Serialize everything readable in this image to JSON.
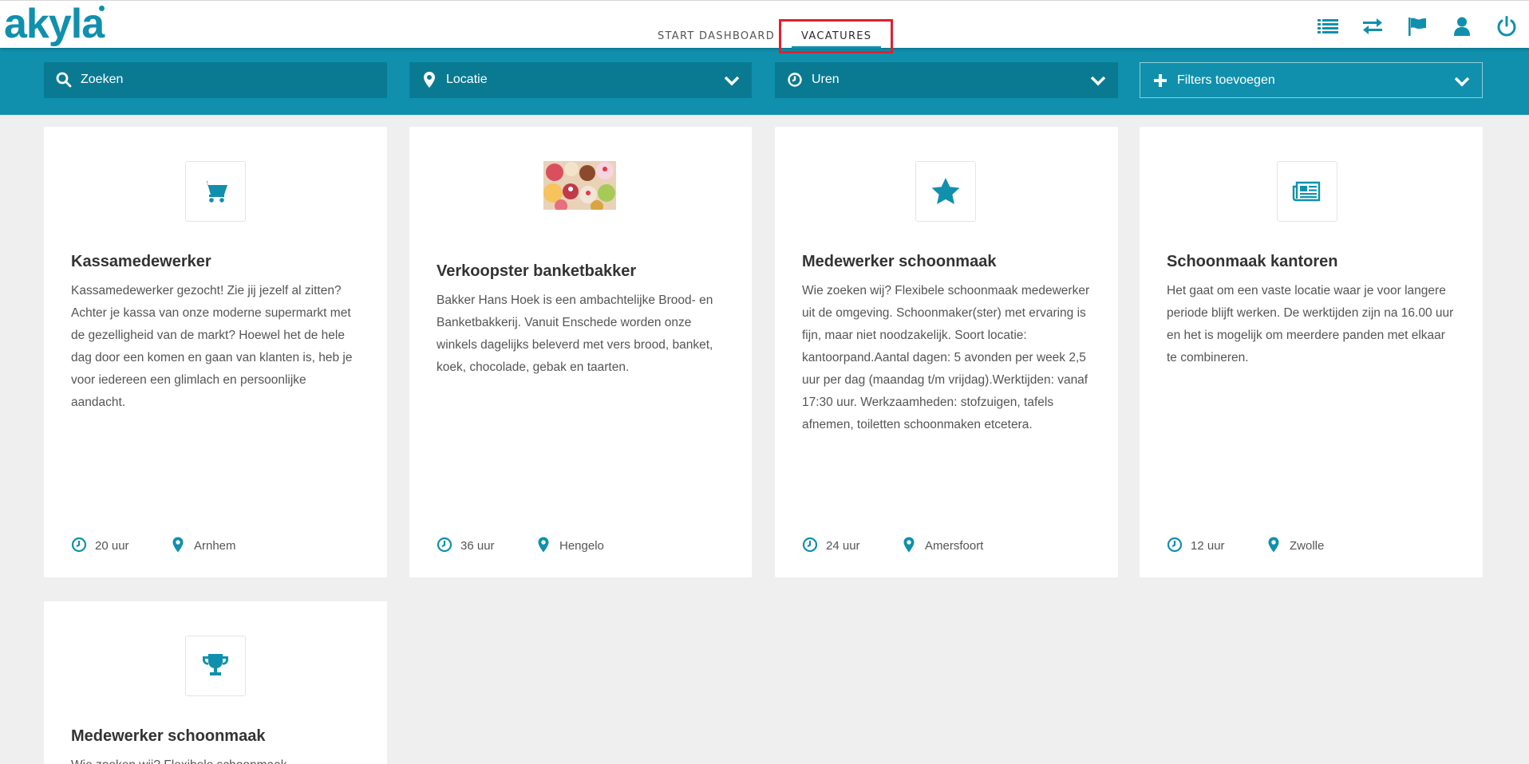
{
  "brand": {
    "logo_text": "akyla",
    "color": "#1090ad"
  },
  "nav": {
    "tabs": [
      {
        "label": "START DASHBOARD",
        "active": false
      },
      {
        "label": "VACATURES",
        "active": true
      }
    ]
  },
  "top_icons": [
    "list-icon",
    "transfer-icon",
    "flag-icon",
    "user-icon",
    "power-icon"
  ],
  "filters": {
    "search": {
      "placeholder": "Zoeken",
      "icon": "search-icon"
    },
    "location": {
      "label": "Locatie",
      "icon": "map-marker-icon"
    },
    "hours": {
      "label": "Uren",
      "icon": "clock-icon"
    },
    "add_filters": {
      "label": "Filters toevoegen",
      "icon": "plus-icon"
    }
  },
  "vacancies": [
    {
      "icon": "shopping-cart-icon",
      "title": "Kassamedewerker",
      "description": "Kassamedewerker gezocht! Zie jij jezelf al zitten? Achter je kassa van onze moderne supermarkt met de gezelligheid van de markt? Hoewel het de hele dag door een komen en gaan van klanten is, heb je voor iedereen een glimlach en persoonlijke aandacht.",
      "hours": "20 uur",
      "location": "Arnhem"
    },
    {
      "icon": "pastries-image",
      "title": "Verkoopster banketbakker",
      "description": "Bakker Hans Hoek is een ambachtelijke Brood- en Banketbakkerij. Vanuit Enschede worden onze winkels dagelijks beleverd met vers brood, banket, koek, chocolade, gebak en taarten.",
      "hours": "36 uur",
      "location": "Hengelo"
    },
    {
      "icon": "star-icon",
      "title": "Medewerker schoonmaak",
      "description": "Wie zoeken wij? Flexibele schoonmaak medewerker uit de omgeving. Schoonmaker(ster) met ervaring is fijn, maar niet noodzakelijk. Soort locatie: kantoorpand.Aantal dagen: 5 avonden per week 2,5 uur per dag (maandag t/m vrijdag).Werktijden: vanaf 17:30 uur. Werkzaamheden: stofzuigen, tafels afnemen, toiletten schoonmaken etcetera.",
      "hours": "24 uur",
      "location": "Amersfoort"
    },
    {
      "icon": "newspaper-icon",
      "title": "Schoonmaak kantoren",
      "description": "Het gaat om een vaste locatie waar je voor langere periode blijft werken. De werktijden zijn na 16.00 uur en het is mogelijk om meerdere panden met elkaar te combineren.",
      "hours": "12 uur",
      "location": "Zwolle"
    },
    {
      "icon": "trophy-icon",
      "title": "Medewerker schoonmaak",
      "description": "Wie zoeken wij? Flexibele schoonmaak",
      "hours": "",
      "location": ""
    }
  ]
}
